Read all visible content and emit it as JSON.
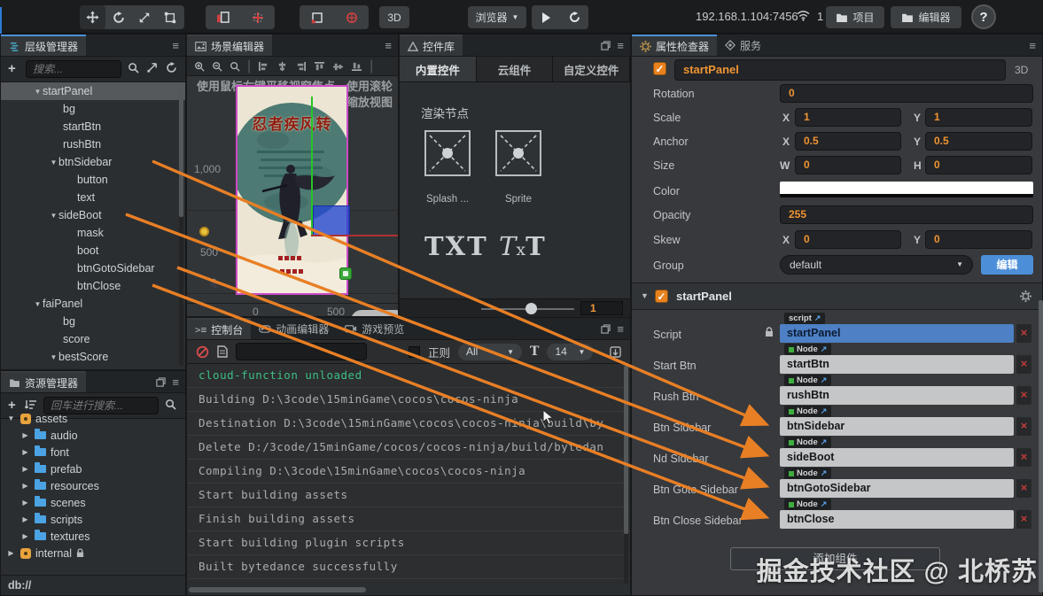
{
  "toolbar": {
    "mode_3d": "3D",
    "browser_label": "浏览器",
    "address": "192.168.1.104:7456",
    "client_count": "1",
    "project_label": "项目",
    "editor_label": "编辑器",
    "help_label": "?"
  },
  "hierarchy": {
    "title": "层级管理器",
    "search_placeholder": "搜索...",
    "tree": [
      "startPanel",
      "bg",
      "startBtn",
      "rushBtn",
      "btnSidebar",
      "button",
      "text",
      "sideBoot",
      "mask",
      "boot",
      "btnGotoSidebar",
      "btnClose",
      "faiPanel",
      "bg",
      "score",
      "bestScore"
    ]
  },
  "assets": {
    "title": "资源管理器",
    "search_placeholder": "回车进行搜索...",
    "tree": [
      "assets",
      "audio",
      "font",
      "prefab",
      "resources",
      "scenes",
      "scripts",
      "textures",
      "internal"
    ],
    "status": "db://"
  },
  "scene": {
    "title": "场景编辑器",
    "hint": "使用鼠标右键平移视窗焦点，使用滚轮缩放视图",
    "poster_title": "忍者疾风转",
    "ruler_v": [
      "1,000",
      "500",
      "0"
    ],
    "ruler_h": [
      "0",
      "500"
    ]
  },
  "widgets": {
    "title": "控件库",
    "tabs": [
      "内置控件",
      "云组件",
      "自定义控件"
    ],
    "section": "渲染节点",
    "item1": "Splash ...",
    "item2": "Sprite",
    "txt1": "TXT",
    "txt2_a": "T",
    "txt2_b": "x",
    "txt2_c": "T",
    "zoom_value": "1"
  },
  "console": {
    "tab_console": "控制台",
    "tab_anim": "动画编辑器",
    "tab_preview": "游戏预览",
    "regex_label": "正则",
    "filter_value": "All",
    "font_label": "T",
    "size_value": "14",
    "lines": [
      "cloud-function unloaded",
      "Building D:\\3code\\15minGame\\cocos\\cocos-ninja",
      "Destination D:\\3code\\15minGame\\cocos\\cocos-ninja\\build\\by",
      "Delete D:/3code/15minGame/cocos/cocos-ninja/build/bytedan",
      "Compiling D:\\3code\\15minGame\\cocos\\cocos-ninja",
      "Start building assets",
      "Finish building assets",
      "Start building plugin scripts",
      "Built bytedance successfully"
    ]
  },
  "inspector": {
    "tab_props": "属性检查器",
    "tab_services": "服务",
    "node_name": "startPanel",
    "mode_3d": "3D",
    "check_mark": "✓",
    "rotation_label": "Rotation",
    "rotation_value": "0",
    "scale_label": "Scale",
    "x_label": "X",
    "y_label": "Y",
    "scale_x": "1",
    "scale_y": "1",
    "anchor_label": "Anchor",
    "anchor_x": "0.5",
    "anchor_y": "0.5",
    "size_label": "Size",
    "w_label": "W",
    "h_label": "H",
    "size_w": "0",
    "size_h": "0",
    "color_label": "Color",
    "opacity_label": "Opacity",
    "opacity_value": "255",
    "skew_label": "Skew",
    "skew_x": "0",
    "skew_y": "0",
    "group_label": "Group",
    "group_value": "default",
    "edit_label": "编辑",
    "component_name": "startPanel",
    "script_badge": "script",
    "node_badge": "Node",
    "close_mark": "×",
    "rows": [
      {
        "label": "Script",
        "value": "startPanel"
      },
      {
        "label": "Start Btn",
        "value": "startBtn"
      },
      {
        "label": "Rush Btn",
        "value": "rushBtn"
      },
      {
        "label": "Btn Sidebar",
        "value": "btnSidebar"
      },
      {
        "label": "Nd Sidebar",
        "value": "sideBoot"
      },
      {
        "label": "Btn Goto Sidebar",
        "value": "btnGotoSidebar"
      },
      {
        "label": "Btn Close Sidebar",
        "value": "btnClose"
      }
    ],
    "add_component": "添加组件"
  },
  "watermark": "掘金技术社区 @ 北桥苏"
}
